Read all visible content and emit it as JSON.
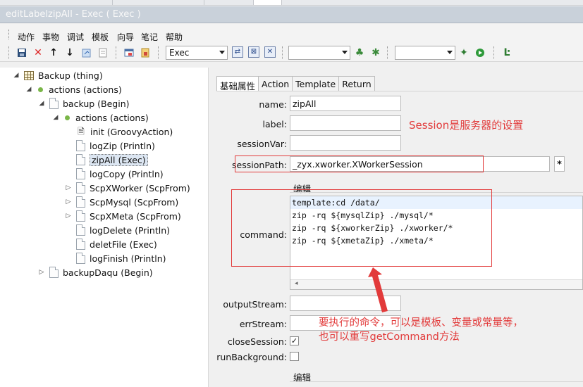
{
  "window": {
    "title": "editLabelzipAll - Exec ( Exec )"
  },
  "menu": {
    "items": [
      "动作",
      "事物",
      "调试",
      "模板",
      "向导",
      "笔记",
      "帮助"
    ]
  },
  "toolbar": {
    "icons": [
      "save-icon",
      "delete-icon",
      "arrow-up-icon",
      "arrow-down-icon",
      "refresh-icon",
      "document-icon",
      "window-icon",
      "image-icon",
      "run-icon",
      "debug-icon"
    ],
    "type_combo": "Exec",
    "empty_combo": "",
    "empty_combo_2": ""
  },
  "tree": {
    "nodes": [
      {
        "label": "Backup (thing)"
      },
      {
        "label": "actions (actions)"
      },
      {
        "label": "backup (Begin)"
      },
      {
        "label": "actions (actions)"
      },
      {
        "label": "init (GroovyAction)"
      },
      {
        "label": "logZip (Println)"
      },
      {
        "label": "zipAll (Exec)"
      },
      {
        "label": "logCopy (Println)"
      },
      {
        "label": "ScpXWorker (ScpFrom)"
      },
      {
        "label": "ScpMysql (ScpFrom)"
      },
      {
        "label": "ScpXMeta (ScpFrom)"
      },
      {
        "label": "logDelete (Println)"
      },
      {
        "label": "deletFile (Exec)"
      },
      {
        "label": "logFinish (Println)"
      },
      {
        "label": "backupDaqu (Begin)"
      }
    ]
  },
  "tabs": [
    "基础属性",
    "Action",
    "Template",
    "Return"
  ],
  "form": {
    "name_label": "name:",
    "name_value": "zipAll",
    "label_label": "label:",
    "label_value": "",
    "sessionVar_label": "sessionVar:",
    "sessionVar_value": "",
    "sessionPath_label": "sessionPath:",
    "sessionPath_value": "_zyx.xworker.XWorkerSession",
    "sessionPath_button": "*",
    "edit_section": "编辑",
    "command_label": "command:",
    "command_lines": [
      "template:cd /data/",
      "zip -rq ${mysqlZip} ./mysql/*",
      "zip -rq ${xworkerZip} ./xworker/*",
      "zip -rq ${xmetaZip} ./xmeta/*"
    ],
    "outputStream_label": "outputStream:",
    "outputStream_value": "",
    "errStream_label": "errStream:",
    "errStream_value": "",
    "closeSession_label": "closeSession:",
    "closeSession_checked": true,
    "runBackground_label": "runBackground:",
    "runBackground_checked": false,
    "edit_section_2": "编辑"
  },
  "annotations": {
    "session_note": "Session是服务器的设置",
    "command_note_1": "要执行的命令，可以是模板、变量或常量等，",
    "command_note_2": "也可以重写getCommand方法"
  },
  "colors": {
    "annotation": "#e23a3a",
    "title_bar": "#c9d1da",
    "selection": "#dce6f2"
  }
}
